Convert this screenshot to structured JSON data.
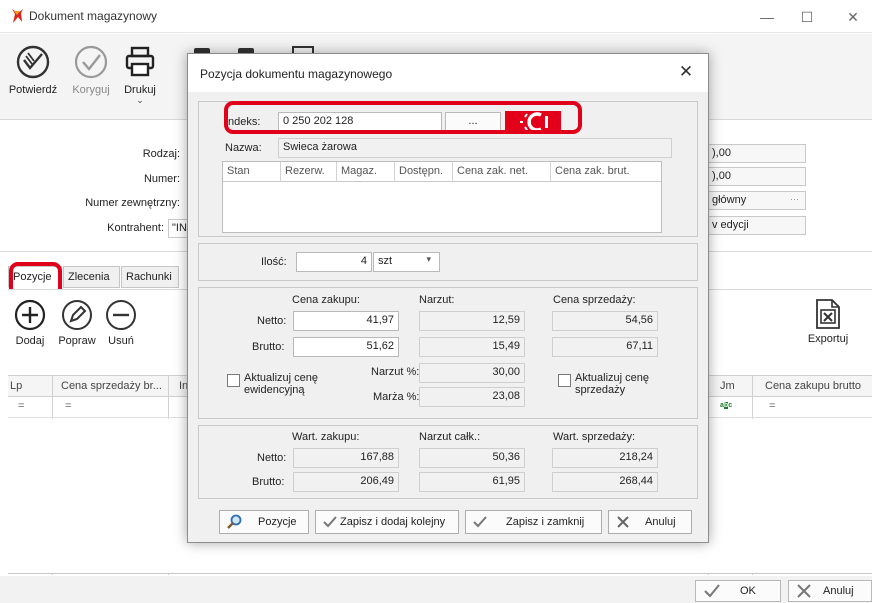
{
  "window": {
    "title": "Dokument magazynowy",
    "minimize": "—",
    "maximize": "☐",
    "close": "✕"
  },
  "ribbon": {
    "confirm": "Potwierdź",
    "correct": "Koryguj",
    "print": "Drukuj"
  },
  "form": {
    "rodzaj_label": "Rodzaj:",
    "numer_label": "Numer:",
    "numer_zewn_label": "Numer zewnętrzny:",
    "kontrahent_label": "Kontrahent:",
    "kontrahent_value": "\"INTE",
    "right_value_1": "),00",
    "right_value_2": "),00",
    "right_value_3": "główny",
    "right_value_3_dots": "···",
    "right_value_4": "v edycji"
  },
  "tabs": [
    "Pozycje",
    "Zlecenia",
    "Rachunki"
  ],
  "grid_toolbar": {
    "add": "Dodaj",
    "edit": "Popraw",
    "remove": "Usuń",
    "export": "Exportuj"
  },
  "grid": {
    "col_lp": "Lp",
    "col_price": "Cena sprzedaży br...",
    "col_in": "In",
    "col_jm": "Jm",
    "col_purchase": "Cena zakupu brutto",
    "filter_eq": "="
  },
  "bottom": {
    "ok": "OK",
    "cancel": "Anuluj"
  },
  "modal": {
    "title": "Pozycja dokumentu magazynowego",
    "close": "✕",
    "indeks_label": "Indeks:",
    "indeks_value": "0 250 202 128",
    "dots": "...",
    "nazwa_label": "Nazwa:",
    "nazwa_value": "Swieca żarowa",
    "stock_columns": [
      "Stan",
      "Rezerw.",
      "Magaz.",
      "Dostępn.",
      "Cena zak. net.",
      "Cena zak. brut."
    ],
    "ilosc_label": "Ilość:",
    "ilosc_value": "4",
    "unit": "szt",
    "cena_zakupu": "Cena zakupu:",
    "narzut": "Narzut:",
    "cena_sprzedazy": "Cena sprzedaży:",
    "netto": "Netto:",
    "brutto": "Brutto:",
    "netto_zakup": "41,97",
    "netto_narzut": "12,59",
    "netto_sprzedaz": "54,56",
    "brutto_zakup": "51,62",
    "brutto_narzut": "15,49",
    "brutto_sprzedaz": "67,11",
    "aktualizuj_ewid": "Aktualizuj cenę ewidencyjną",
    "narzut_pct_label": "Narzut %:",
    "narzut_pct": "30,00",
    "marza_pct_label": "Marża %:",
    "marza_pct": "23,08",
    "aktualizuj_sprz": "Aktualizuj cenę sprzedaży",
    "wart_zakupu": "Wart. zakupu:",
    "narzut_calk": "Narzut całk.:",
    "wart_sprzedazy": "Wart. sprzedaży:",
    "w_netto_zakup": "167,88",
    "w_netto_narzut": "50,36",
    "w_netto_sprzedaz": "218,24",
    "w_brutto_zakup": "206,49",
    "w_brutto_narzut": "61,95",
    "w_brutto_sprzedaz": "268,44",
    "btn_pozycje": "Pozycje",
    "btn_zapisz_dodaj": "Zapisz i dodaj kolejny",
    "btn_zapisz_zamknij": "Zapisz i zamknij",
    "btn_anuluj": "Anuluj"
  },
  "colors": {
    "highlight": "#e0001a",
    "logo": "#e3001b",
    "check": "#3c8fd6"
  }
}
